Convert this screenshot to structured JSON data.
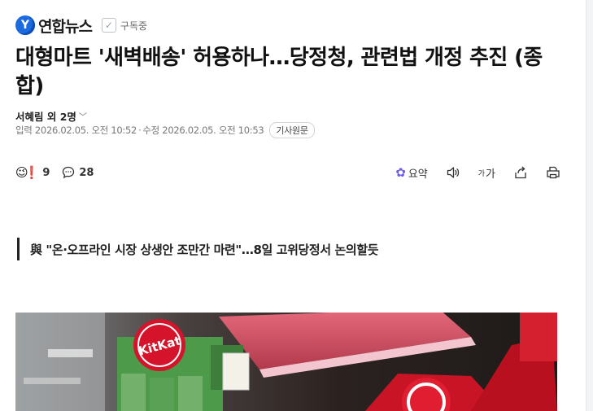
{
  "publisher": {
    "name": "연합뉴스",
    "subscribe_label": "구독중"
  },
  "article": {
    "headline": "대형마트 '새벽배송' 허용하나…당정청, 관련법 개정 추진 (종합)",
    "byline": "서혜림 외 2명",
    "date_input": "입력 2026.02.05. 오전 10:52",
    "date_edit": "수정 2026.02.05. 오전 10:53",
    "original_button": "기사원문",
    "subheading": "與 \"온·오프라인 시장 상생안 조만간 마련\"…8일 고위당정서 논의할듯"
  },
  "actions": {
    "reaction_count": "9",
    "comment_count": "28",
    "summary_label": "요약",
    "font_label": "가"
  },
  "photo": {
    "brand_text": "KitKat"
  },
  "colors": {
    "logo_blue": "#1c6ae0",
    "summary_purple": "#6b5cf0",
    "kitkat_red": "#d5142b",
    "shelf_green": "#4d9a4a"
  }
}
